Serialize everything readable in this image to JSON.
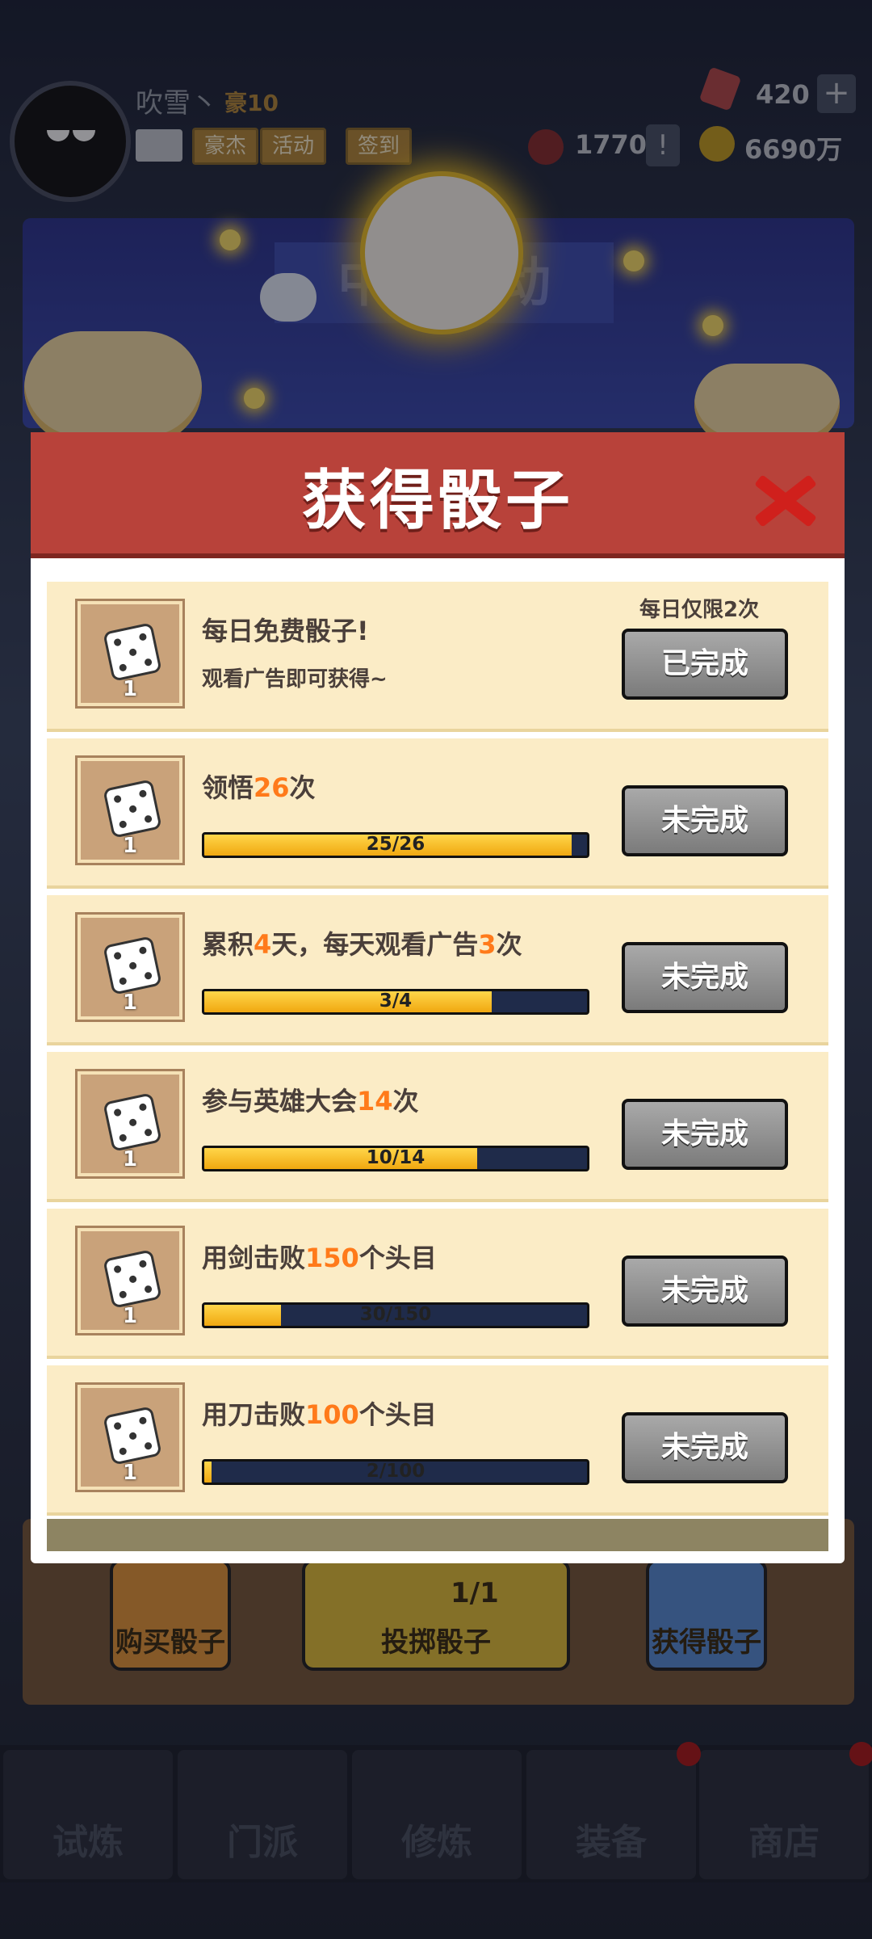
{
  "player": {
    "name": "吹雪丶",
    "rank": "豪10"
  },
  "header_tags": [
    "豪杰",
    "活动",
    "签到"
  ],
  "resources": {
    "gems": "420",
    "tickets": "1770",
    "gold": "6690万"
  },
  "banner": {
    "title": "中秋活动"
  },
  "modal": {
    "title": "获得骰子",
    "tasks": [
      {
        "title_parts": [
          "每日免费骰子!",
          "",
          ""
        ],
        "subtitle": "观看广告即可获得~",
        "limit": "每日仅限2次",
        "reward_count": "1",
        "button": "已完成"
      },
      {
        "title_parts": [
          "领悟",
          "26",
          "次"
        ],
        "reward_count": "1",
        "progress_text": "25/26",
        "progress": 0.96,
        "button": "未完成"
      },
      {
        "title_parts": [
          "累积",
          "4",
          "天，每天观看广告",
          "3",
          "次"
        ],
        "reward_count": "1",
        "progress_text": "3/4",
        "progress": 0.75,
        "button": "未完成"
      },
      {
        "title_parts": [
          "参与英雄大会",
          "14",
          "次"
        ],
        "reward_count": "1",
        "progress_text": "10/14",
        "progress": 0.714,
        "button": "未完成"
      },
      {
        "title_parts": [
          "用剑击败",
          "150",
          "个头目"
        ],
        "reward_count": "1",
        "progress_text": "30/150",
        "progress": 0.2,
        "button": "未完成"
      },
      {
        "title_parts": [
          "用刀击败",
          "100",
          "个头目"
        ],
        "reward_count": "1",
        "progress_text": "2/100",
        "progress": 0.02,
        "button": "未完成"
      }
    ]
  },
  "bottom_buttons": {
    "buy": "购买骰子",
    "roll": "投掷骰子",
    "roll_count": "1/1",
    "get": "获得骰子"
  },
  "nav": [
    "试炼",
    "门派",
    "修炼",
    "装备",
    "商店"
  ],
  "colors": {
    "header_red": "#b8423a",
    "row_bg": "#fbecc6",
    "highlight": "#ff7a1a",
    "bar_fill": "#f0a810"
  }
}
